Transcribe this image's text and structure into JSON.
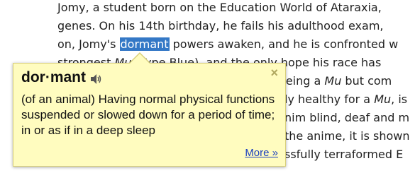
{
  "article": {
    "line1": "Jomy, a student born on the Education World of Ataraxia,",
    "line2": "genes. On his 14th birthday, he fails his adulthood exam,",
    "line3_before": "on, Jomy's",
    "line3_highlight": "dormant",
    "line3_after": "powers awaken, and he is confronted w",
    "line4a": "strongest ",
    "line4b": "Mu",
    "line4c": " (Type Blue), and the only hope his race has",
    "line5a": "m being a ",
    "line5b": "Mu",
    "line5c": " but com",
    "line6a": "ly healthy for a ",
    "line6b": "Mu",
    "line6c": ", is",
    "line7": "nim blind, deaf and m",
    "line8": "the anime, it is shown",
    "line9": "ssfully terraformed E"
  },
  "dictionary_popup": {
    "headword": "dor·mant",
    "speaker_icon": "speaker-icon",
    "close_label": "×",
    "definition": "(of an animal) Having normal physical functions suspended or slowed down for a period of time; in or as if in a deep sleep",
    "more_link": "More »"
  },
  "colors": {
    "popup_bg": "#fffcbf",
    "highlight": "#3478c6",
    "link": "#1a3fbf"
  }
}
